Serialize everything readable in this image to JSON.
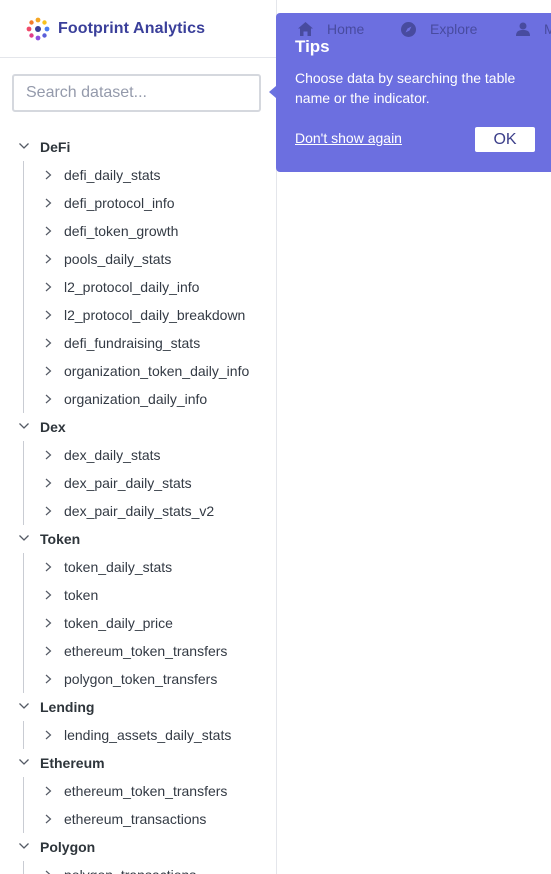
{
  "brand": {
    "name": "Footprint Analytics"
  },
  "search": {
    "placeholder": "Search dataset..."
  },
  "top_nav": [
    {
      "label": "Home",
      "icon": "home-icon"
    },
    {
      "label": "Explore",
      "icon": "compass-icon"
    },
    {
      "label": "M",
      "icon": "user-icon"
    }
  ],
  "tips": {
    "title": "Tips",
    "body": "Choose data by searching the table name or the indicator.",
    "dismiss_label": "Don't show again",
    "ok_label": "OK"
  },
  "tree": [
    {
      "label": "DeFi",
      "items": [
        "defi_daily_stats",
        "defi_protocol_info",
        "defi_token_growth",
        "pools_daily_stats",
        "l2_protocol_daily_info",
        "l2_protocol_daily_breakdown",
        "defi_fundraising_stats",
        "organization_token_daily_info",
        "organization_daily_info"
      ]
    },
    {
      "label": "Dex",
      "items": [
        "dex_daily_stats",
        "dex_pair_daily_stats",
        "dex_pair_daily_stats_v2"
      ]
    },
    {
      "label": "Token",
      "items": [
        "token_daily_stats",
        "token",
        "token_daily_price",
        "ethereum_token_transfers",
        "polygon_token_transfers"
      ]
    },
    {
      "label": "Lending",
      "items": [
        "lending_assets_daily_stats"
      ]
    },
    {
      "label": "Ethereum",
      "items": [
        "ethereum_token_transfers",
        "ethereum_transactions"
      ]
    },
    {
      "label": "Polygon",
      "items": [
        "polygon_transactions"
      ]
    }
  ],
  "colors": {
    "accent": "#6c6fe0",
    "brand_text": "#3a3f9a"
  }
}
